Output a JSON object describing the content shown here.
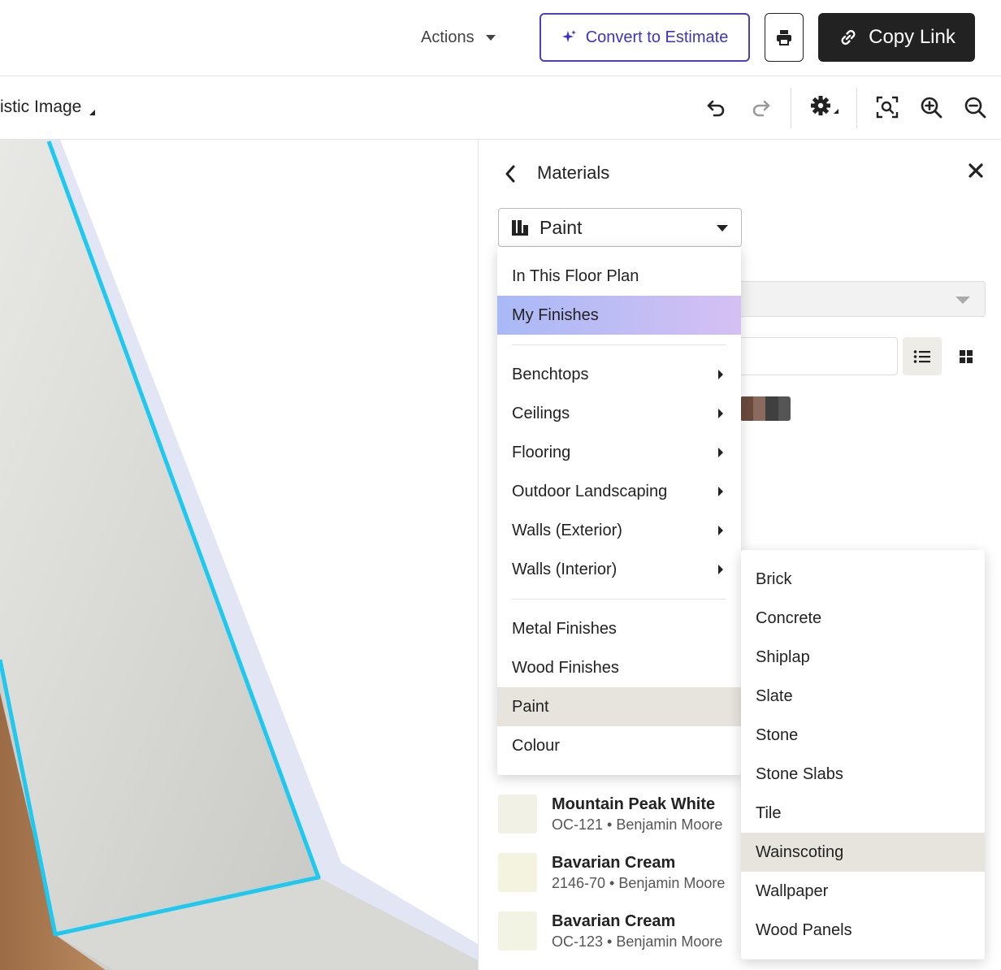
{
  "header": {
    "actions_label": "Actions",
    "convert_label": "Convert to Estimate",
    "copy_link_label": "Copy Link"
  },
  "toolbar": {
    "view_label": "istic Image"
  },
  "panel": {
    "title": "Materials",
    "selected_category": "Paint"
  },
  "category_menu": {
    "top_items": [
      {
        "label": "In This Floor Plan"
      },
      {
        "label": "My Finishes"
      }
    ],
    "submenu_items": [
      {
        "label": "Benchtops"
      },
      {
        "label": "Ceilings"
      },
      {
        "label": "Flooring"
      },
      {
        "label": "Outdoor Landscaping"
      },
      {
        "label": "Walls (Exterior)"
      },
      {
        "label": "Walls (Interior)"
      }
    ],
    "bottom_items": [
      {
        "label": "Metal Finishes"
      },
      {
        "label": "Wood Finishes"
      },
      {
        "label": "Paint"
      },
      {
        "label": "Colour"
      }
    ]
  },
  "walls_exterior_menu": {
    "items": [
      {
        "label": "Brick"
      },
      {
        "label": "Concrete"
      },
      {
        "label": "Shiplap"
      },
      {
        "label": "Slate"
      },
      {
        "label": "Stone"
      },
      {
        "label": "Stone Slabs"
      },
      {
        "label": "Tile"
      },
      {
        "label": "Wainscoting"
      },
      {
        "label": "Wallpaper"
      },
      {
        "label": "Wood Panels"
      }
    ]
  },
  "paint_list": [
    {
      "name": "Mountain Peak White",
      "code": "OC-121 • Benjamin Moore",
      "color": "#f2f1e6"
    },
    {
      "name": "Bavarian Cream",
      "code": "2146-70 • Benjamin Moore",
      "color": "#f4f3df"
    },
    {
      "name": "Bavarian Cream",
      "code": "OC-123 • Benjamin Moore",
      "color": "#f3f3e3"
    }
  ],
  "colors": {
    "accent": "#3b35c4",
    "dark_button": "#222222",
    "wall_outline": "#1ec8ee",
    "highlight_start": "#a9b9f6",
    "highlight_end": "#d5c0f3",
    "selected_row": "#e7e4dd"
  },
  "icons": {
    "sparkle": "sparkle-icon",
    "print": "printer-icon",
    "link": "link-icon",
    "undo": "undo-icon",
    "redo": "redo-icon",
    "settings": "gear-icon",
    "zoom_fit": "zoom-fit-icon",
    "zoom_in": "zoom-in-icon",
    "zoom_out": "zoom-out-icon",
    "back": "chevron-left-icon",
    "close": "close-icon",
    "list_view": "list-view-icon",
    "grid_view": "grid-view-icon",
    "library": "library-icon"
  }
}
